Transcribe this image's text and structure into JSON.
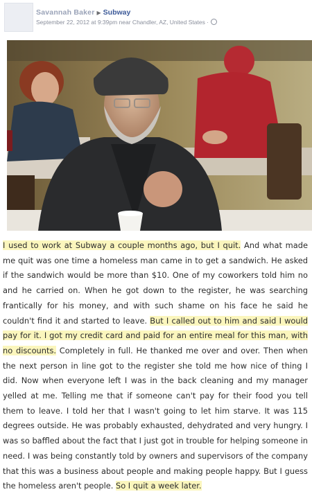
{
  "header": {
    "author": "Savannah Baker",
    "place": "Subway",
    "meta": "September 22, 2012 at 9:39pm near Chandler, AZ, United States ·"
  },
  "photo": {
    "alt_icon": "photo"
  },
  "story": [
    {
      "text": "I used to work at Subway a couple months ago, but I quit.",
      "highlight": true
    },
    {
      "text": " And what made me quit was one time a homeless man came in to get a sandwich. He asked if the sandwich would be more than $10. One of my coworkers told him no and he carried on. When he got down to the register, he was searching frantically for his money, and with such shame on his face he said he couldn't find it and started to leave. ",
      "highlight": false
    },
    {
      "text": "But I called out to him and said I would pay for it. I got my credit card and paid for an entire meal for this man, with no discounts.",
      "highlight": true
    },
    {
      "text": " Completely in full. He thanked me over and over. Then when the next person in line got to the register she told me how nice of thing I did. Now when everyone left I was in the back cleaning and my manager yelled at me. Telling me that if someone can't pay for their food you tell them to leave. I told her that I wasn't going to let him starve. It was 115 degrees outside. He was probably exhausted, dehydrated and very hungry. I was so baffled about the fact that I just got in trouble for helping someone in need. I was being constantly told by owners and supervisors of the company that this was a business about people and making people happy. But I guess the homeless aren't people. ",
      "highlight": false
    },
    {
      "text": "So I quit a week later.",
      "highlight": true
    }
  ]
}
